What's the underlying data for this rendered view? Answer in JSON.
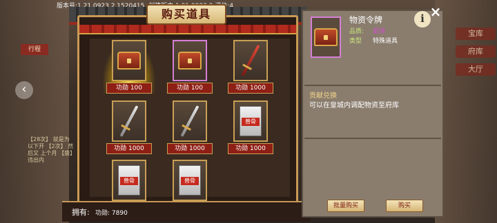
{
  "version_text": "版本号:1.21.0923.2.1520415, 创建版本:1.21.0923.2.评位:4",
  "shop": {
    "title": "购买道具",
    "owned_label": "拥有:",
    "owned_value": "功勋: 7890",
    "items": [
      {
        "icon": "chest-icon",
        "price": "功勋 100",
        "highlight": true
      },
      {
        "icon": "chest-icon",
        "price": "功勋 100",
        "selected": true
      },
      {
        "icon": "red-sword-icon",
        "price": "功勋 1000"
      },
      {
        "icon": "sword-icon",
        "price": "功勋 1000"
      },
      {
        "icon": "sword-icon",
        "price": "功勋 1000"
      },
      {
        "icon": "book-icon",
        "price": "功勋 1000",
        "tag": "兽骨"
      },
      {
        "icon": "book-icon",
        "tag": "兽骨"
      },
      {
        "icon": "book-icon",
        "tag": "兽骨"
      }
    ]
  },
  "detail": {
    "name": "物资令牌",
    "quality_label": "品质:",
    "quality_value": "史诗",
    "type_label": "类型",
    "type_value": "特殊道具",
    "section_title": "贡献兑换",
    "description": "可以在皇城内调配物资至府库",
    "batch_buy": "批量购买",
    "buy": "购买",
    "close": "×",
    "info": "i"
  },
  "background": {
    "left_tab": "行程",
    "right_labels": [
      "宝库",
      "府库",
      "大厅"
    ],
    "chat": "【28次】 就是为 以下开 【2次】 然后又 上个月 【盛】 违出内"
  },
  "colors": {
    "frame_gold": "#c99a55",
    "price_red": "#8e1f15",
    "epic_purple": "#d84ad8",
    "label_green": "#c9e87a"
  }
}
